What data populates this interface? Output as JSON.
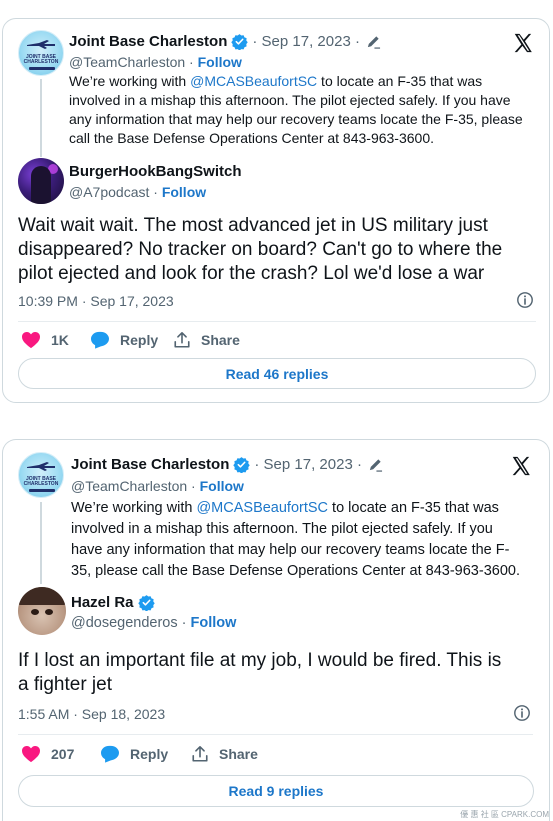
{
  "colors": {
    "accent": "#1d77c9",
    "verified": "#1d9bf0",
    "like": "#f91880",
    "muted": "#536471"
  },
  "tweets": [
    {
      "quoted": {
        "name": "Joint Base Charleston",
        "date": "· Sep 17, 2023 ·",
        "handle": "@TeamCharleston ·",
        "follow": "Follow",
        "text_before": "We’re working with ",
        "mention": "@MCASBeaufortSC",
        "text_after": " to locate an F-35 that was involved in a mishap this afternoon. The pilot ejected safely. If you have any information that may help our recovery teams locate the F-35, please call the Base Defense Operations Center at 843-963-3600.",
        "avatar_text": "JOINT BASE CHARLESTON"
      },
      "reply": {
        "name": "BurgerHookBangSwitch",
        "handle": "@A7podcast ·",
        "follow": "Follow",
        "text": "Wait wait wait. The most advanced jet in US military just disappeared? No tracker on board? Can't go to where the pilot ejected and look for the crash? Lol we'd lose a war",
        "timestamp": "10:39 PM · Sep 17, 2023",
        "likes": "1K",
        "reply_label": "Reply",
        "share_label": "Share",
        "read_replies": "Read 46 replies"
      }
    },
    {
      "quoted": {
        "name": "Joint Base Charleston",
        "date": "· Sep 17, 2023 ·",
        "handle": "@TeamCharleston ·",
        "follow": "Follow",
        "text_before": "We’re working with ",
        "mention": "@MCASBeaufortSC",
        "text_after": " to locate an F-35 that was involved in a mishap this afternoon. The pilot ejected safely. If you have any information that may help our recovery teams locate the F-35, please call the Base Defense Operations Center at 843-963-3600.",
        "avatar_text": "JOINT BASE CHARLESTON"
      },
      "reply": {
        "name": "Hazel Ra",
        "handle": "@dosegenderos ·",
        "follow": "Follow",
        "text": "If I lost an important file at my  job, I would be fired. This is a fighter jet",
        "timestamp": "1:55 AM · Sep 18, 2023",
        "likes": "207",
        "reply_label": "Reply",
        "share_label": "Share",
        "read_replies": "Read 9 replies"
      }
    }
  ],
  "watermark": "優 惠 社 區 CPARK.COM"
}
